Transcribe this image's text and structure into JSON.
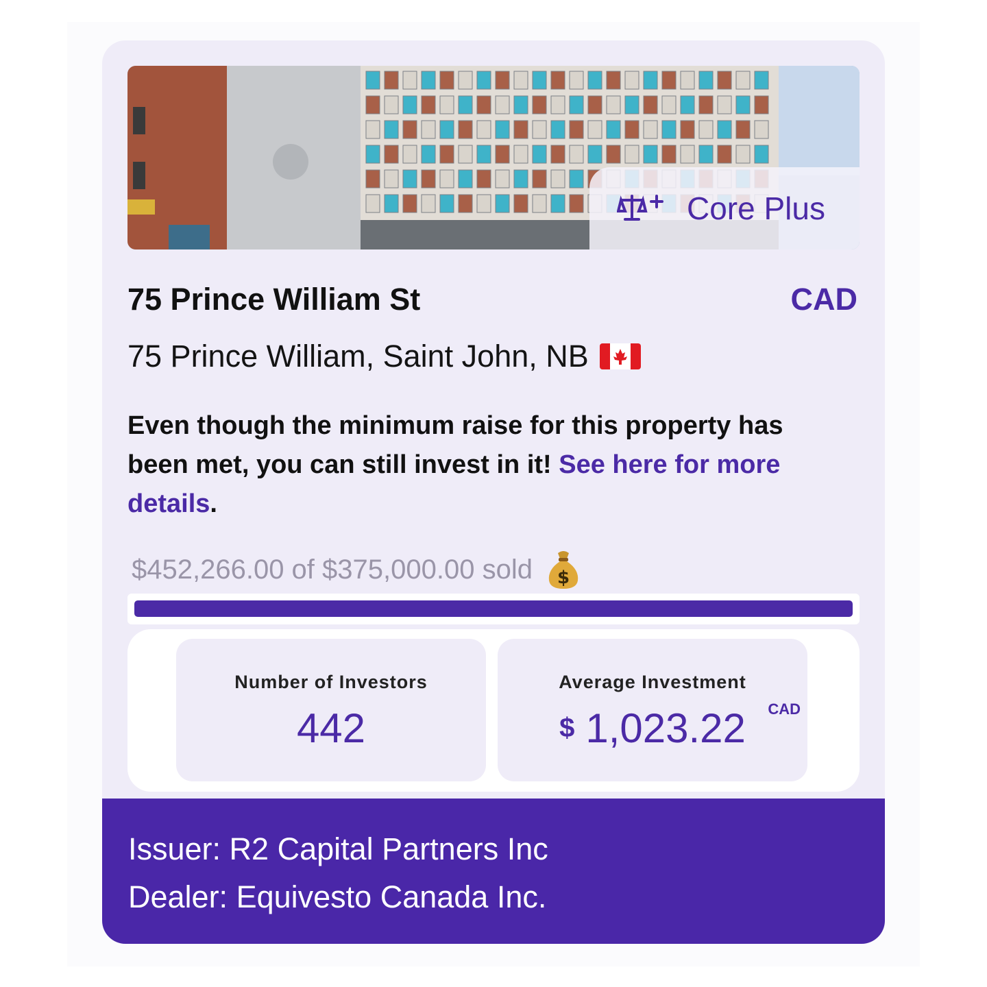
{
  "property": {
    "badge_label": "Core Plus",
    "badge_icon": "scale-plus-icon",
    "title": "75 Prince William St",
    "currency": "CAD",
    "address": "75 Prince William, Saint John, NB",
    "flag_icon": "canada-flag-icon"
  },
  "notice": {
    "text": "Even though the minimum raise for this property has been met, you can still invest in it! ",
    "link_text": "See here for more details",
    "trailing": "."
  },
  "funding": {
    "sold_text": "$452,266.00 of $375,000.00 sold",
    "sold_icon": "money-bag-icon",
    "progress_percent": 100
  },
  "stats": {
    "investors_label": "Number of Investors",
    "investors_value": "442",
    "average_label": "Average Investment",
    "average_symbol": "$",
    "average_value": "1,023.22",
    "average_unit": "CAD"
  },
  "footer": {
    "issuer": "Issuer: R2 Capital Partners Inc",
    "dealer": "Dealer: Equivesto Canada Inc."
  },
  "colors": {
    "accent": "#4b2aa6",
    "card_bg": "#efecf8",
    "footer_bg": "#4a27a8"
  }
}
